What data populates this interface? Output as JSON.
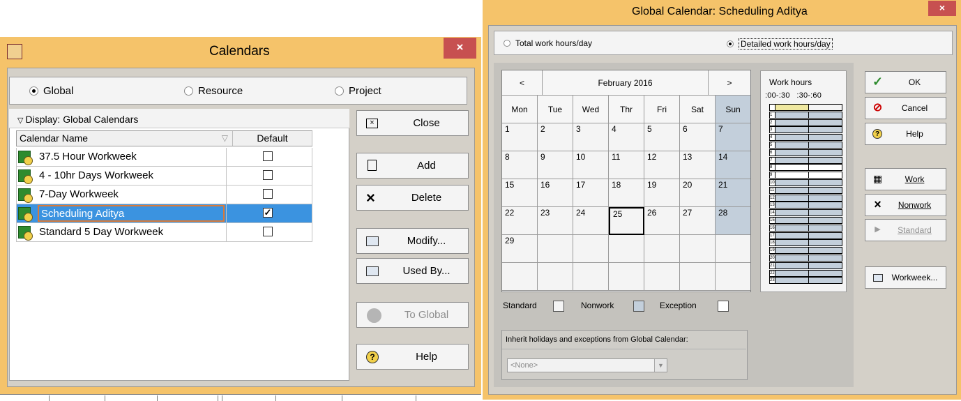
{
  "calendars_dialog": {
    "title": "Calendars",
    "close_glyph": "×",
    "scope_options": [
      {
        "label": "Global",
        "selected": true
      },
      {
        "label": "Resource",
        "selected": false
      },
      {
        "label": "Project",
        "selected": false
      }
    ],
    "display_label": "Display: Global Calendars",
    "columns": {
      "name": "Calendar Name",
      "default": "Default"
    },
    "rows": [
      {
        "name": "37.5 Hour Workweek",
        "default": false
      },
      {
        "name": "4 - 10hr Days Workweek",
        "default": false
      },
      {
        "name": "7-Day Workweek",
        "default": false
      },
      {
        "name": "Scheduling Aditya",
        "default": true,
        "selected": true
      },
      {
        "name": "Standard 5 Day Workweek",
        "default": false
      }
    ],
    "buttons": {
      "close": "Close",
      "add": "Add",
      "delete": "Delete",
      "modify": "Modify...",
      "used_by": "Used By...",
      "to_global": "To Global",
      "help": "Help"
    }
  },
  "global_calendar_dialog": {
    "title": "Global Calendar: Scheduling Aditya",
    "close_glyph": "×",
    "mode_options": [
      {
        "label": "Total work hours/day",
        "selected": false
      },
      {
        "label": "Detailed work hours/day",
        "selected": true
      }
    ],
    "calendar": {
      "prev": "<",
      "next": ">",
      "month_label": "February 2016",
      "weekdays": [
        "Mon",
        "Tue",
        "Wed",
        "Thr",
        "Fri",
        "Sat",
        "Sun"
      ],
      "weeks": [
        [
          "1",
          "2",
          "3",
          "4",
          "5",
          "6",
          "7"
        ],
        [
          "8",
          "9",
          "10",
          "11",
          "12",
          "13",
          "14"
        ],
        [
          "15",
          "16",
          "17",
          "18",
          "19",
          "20",
          "21"
        ],
        [
          "22",
          "23",
          "24",
          "25",
          "26",
          "27",
          "28"
        ],
        [
          "29",
          "",
          "",
          "",
          "",
          "",
          ""
        ],
        [
          "",
          "",
          "",
          "",
          "",
          "",
          ""
        ]
      ],
      "today": "25"
    },
    "legend": {
      "standard": "Standard",
      "nonwork": "Nonwork",
      "exception": "Exception"
    },
    "inherit": {
      "label": "Inherit holidays and exceptions from Global Calendar:",
      "value": "<None>"
    },
    "work_hours": {
      "title": "Work hours",
      "subheader": ":00-:30   :30-:60",
      "hours": [
        "",
        "1",
        "2",
        "3",
        "4",
        "5",
        "6",
        "7",
        "8",
        "9",
        "10",
        "11",
        "12",
        "13",
        "14",
        "15",
        "16",
        "17",
        "18",
        "19",
        "20",
        "21",
        "22",
        "23"
      ]
    },
    "buttons": {
      "ok": "OK",
      "cancel": "Cancel",
      "help": "Help",
      "work": "Work",
      "nonwork": "Nonwork",
      "standard": "Standard",
      "workweek": "Workweek..."
    },
    "colors": {
      "nonwork": "#c3cfdb",
      "standard": "#f4f4f4",
      "exception": "#ffffff"
    }
  }
}
